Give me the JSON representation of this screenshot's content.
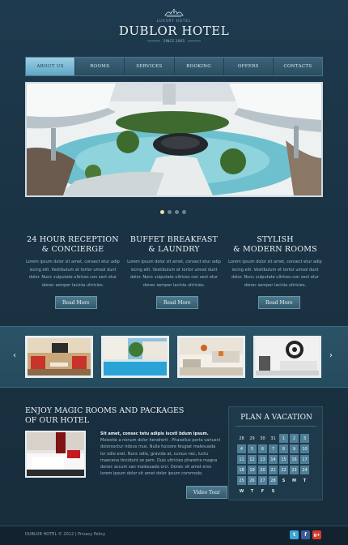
{
  "header": {
    "tagline": "LUXURY HOTEL",
    "title": "DUBLOR HOTEL",
    "since": "SINCE 2005"
  },
  "nav": {
    "items": [
      {
        "label": "ABOUT US",
        "active": true
      },
      {
        "label": "ROOMS"
      },
      {
        "label": "SERVICES"
      },
      {
        "label": "BOOKING"
      },
      {
        "label": "OFFERS"
      },
      {
        "label": "CONTACTS"
      }
    ]
  },
  "slider": {
    "dot_count": 4,
    "active_index": 0
  },
  "features": [
    {
      "title_line1": "24 HOUR RECEPTION",
      "title_line2": "& CONCIERGE",
      "text": "Lorem ipsum dolor sit amet, consect etur adip iscing elit. Vestibulum et tortor umsol dunt dolor. Nunc vulputate ultrices con sect etur donec semper lacinia ultricies.",
      "button": "Read More"
    },
    {
      "title_line1": "BUFFET BREAKFAST",
      "title_line2": "& LAUNDRY",
      "text": "Lorem ipsum dolor sit amet, consect etur adip iscing elit. Vestibulum et tortor umsol dunt dolor. Nunc vulputate ultrices con sect etur donec semper lacinia ultricies.",
      "button": "Read More"
    },
    {
      "title_line1": "STYLISH",
      "title_line2": "& MODERN ROOMS",
      "text": "Lorem ipsum dolor sit amet, consect etur adip iscing elit. Vestibulum et tortor umsol dunt dolor. Nunc vulputate ultrices con sect etur donec semper lacinia ultricies.",
      "button": "Read More"
    }
  ],
  "gallery": {
    "prev": "‹",
    "next": "›"
  },
  "enjoy": {
    "title_line1": "ENJOY MAGIC ROOMS AND PACKAGES",
    "title_line2": "OF OUR HOTEL",
    "lead": "Sit amet, consec tetu adipis iscstl bdum ipsum.",
    "body": "Molestie a nonum dolor hendrerit . Phasellus porta variusnl dolorsoctur ridous mus. Nulla fucoore feugiat malesuada lor odio erat. Nunc odio, gravida at, cursus nec, luctu maecena tincidunt se pem. Duis ultricies pharetra magna donec accum san malesuada orci. Donec sit amet eros lorem ipsum dolor sit amet dolor ipsum commodo.",
    "button": "Video Tour"
  },
  "calendar": {
    "title": "PLAN A VACATION",
    "prev_days": [
      "28",
      "29",
      "30",
      "31"
    ],
    "days": [
      "1",
      "2",
      "3",
      "4",
      "5",
      "6",
      "7",
      "8",
      "9",
      "10",
      "11",
      "12",
      "13",
      "14",
      "15",
      "16",
      "17",
      "18",
      "19",
      "20",
      "21",
      "22",
      "23",
      "24",
      "25",
      "26",
      "27",
      "28"
    ],
    "weekdays": [
      "S",
      "M",
      "T",
      "W",
      "T",
      "F",
      "S"
    ]
  },
  "footer": {
    "text": "DUBLOR HOTEL © 2012 | Privacy Policy"
  },
  "colors": {
    "accent": "#5fa5c4",
    "background": "#1b2f3e",
    "calendar_day": "#4f7f97"
  },
  "social": [
    {
      "icon": "twitter-icon",
      "glyph": "t",
      "color": "#3aa7d8"
    },
    {
      "icon": "facebook-icon",
      "glyph": "f",
      "color": "#3b5b9a"
    },
    {
      "icon": "google-plus-icon",
      "glyph": "g+",
      "color": "#d43b2b"
    }
  ]
}
